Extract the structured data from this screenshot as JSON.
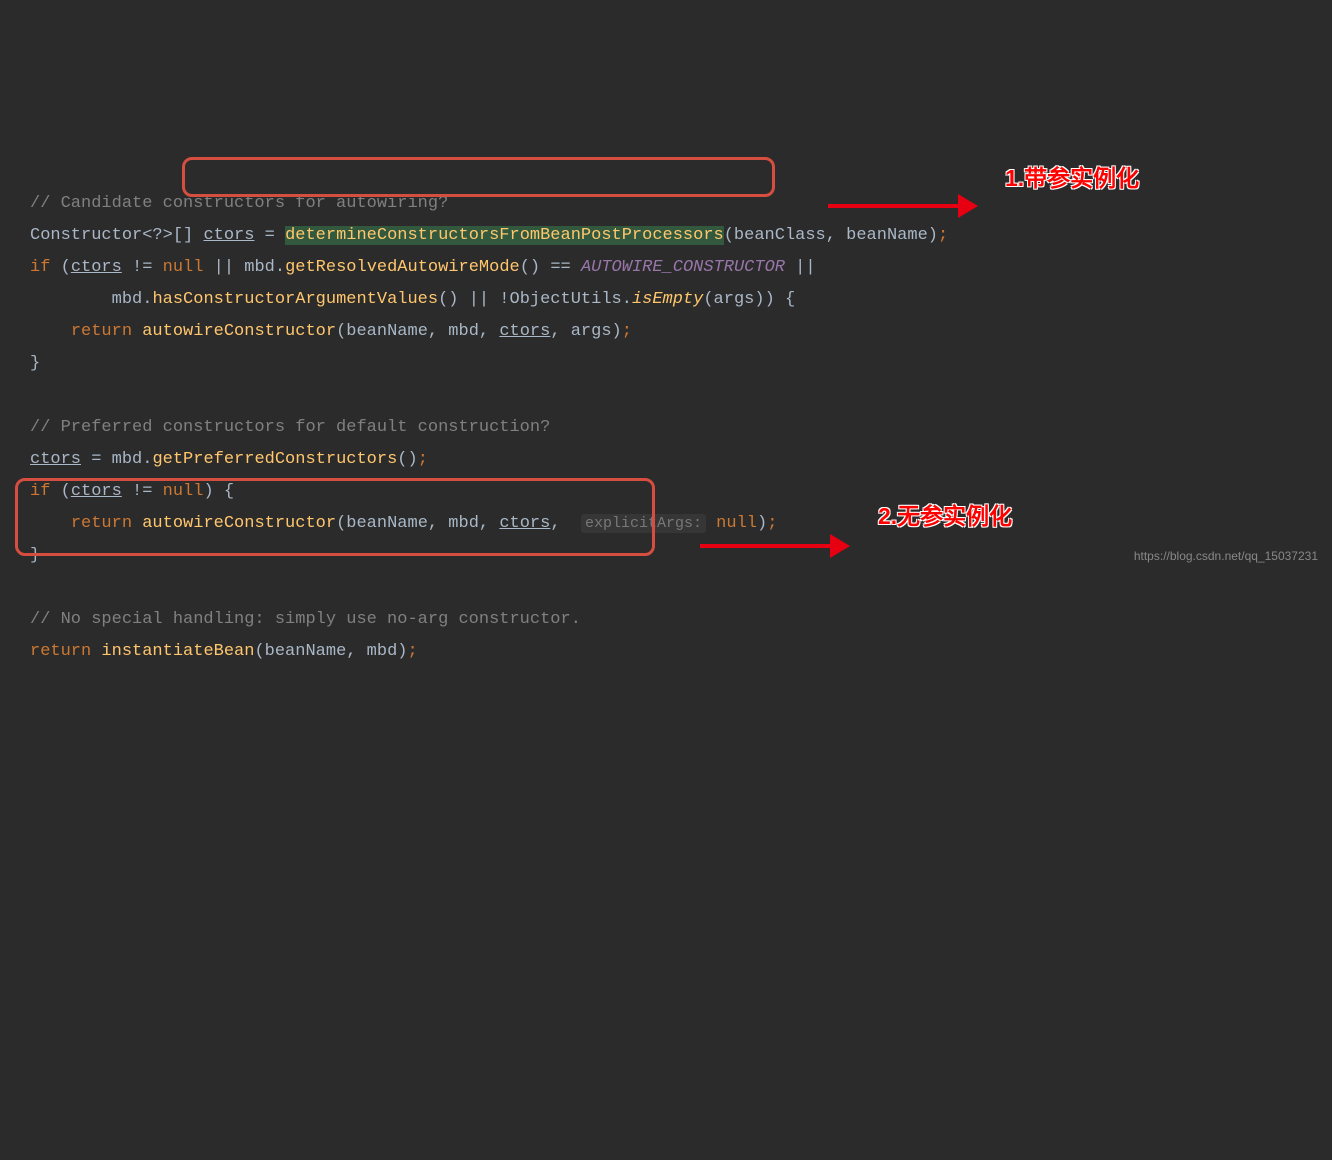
{
  "code": {
    "comment1": "// Candidate constructors for autowiring?",
    "type1": "Constructor",
    "generic": "<?>[]",
    "var_ctors": "ctors",
    "eq": " = ",
    "m_determine": "determineConstructorsFromBeanPostProcessors",
    "args_determine": "(beanClass, beanName)",
    "kw_if": "if",
    "cond1_open": " (",
    "cond1_a": " != ",
    "kw_null": "null",
    "cond1_b": " || mbd.",
    "m_getResolved": "getResolvedAutowireMode",
    "cond1_c": "() == ",
    "const_autowire": "AUTOWIRE_CONSTRUCTOR",
    "cond1_d": " ||",
    "cond2_a": "mbd.",
    "m_hasCtorArgs": "hasConstructorArgumentValues",
    "cond2_b": "() || !ObjectUtils.",
    "m_isEmpty": "isEmpty",
    "cond2_c": "(args)) ",
    "kw_return": "return",
    "m_autowire": "autowireConstructor",
    "args_autowire1": "(beanName, mbd, ",
    "args_autowire1b": ", args)",
    "comment2": "// Preferred constructors for default construction?",
    "m_getPreferred": "getPreferredConstructors",
    "args_getPreferred": "()",
    "cond3_a": " != ",
    "cond3_close": ") ",
    "args_autowire2a": "(beanName, mbd, ",
    "hint_explicit": "explicitArgs:",
    "args_autowire2c": ")",
    "comment3": "// No special handling: simply use no-arg constructor.",
    "m_instantiate": "instantiateBean",
    "args_instantiate": "(beanName, mbd)",
    "semicolon": ";",
    "braceO": "{",
    "braceC": "}"
  },
  "annotations": {
    "a1": "1.带参实例化",
    "a2": "2.无参实例化"
  },
  "watermark": "https://blog.csdn.net/qq_15037231"
}
